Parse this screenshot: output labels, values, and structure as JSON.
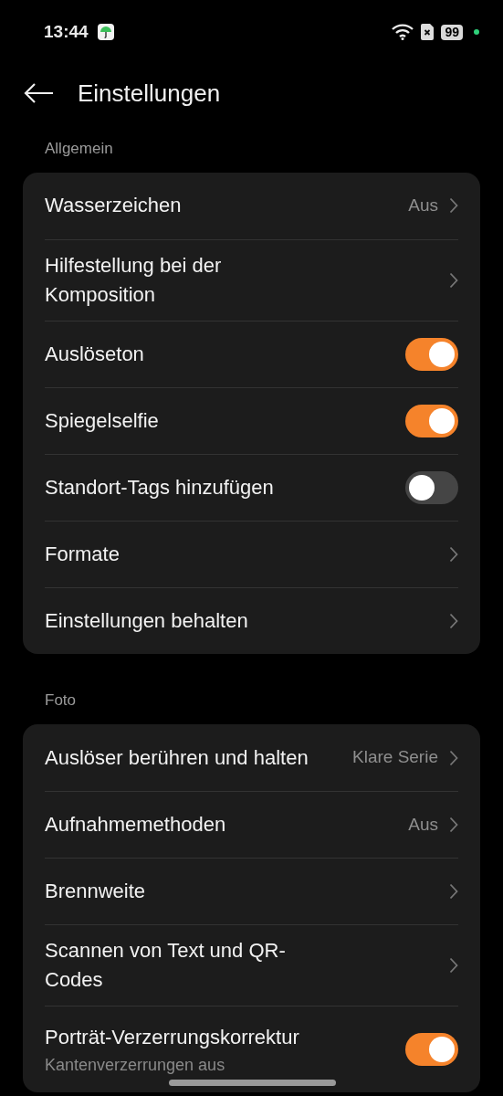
{
  "status_bar": {
    "time": "13:44",
    "battery": "99"
  },
  "header": {
    "title": "Einstellungen"
  },
  "sections": [
    {
      "title": "Allgemein",
      "items": [
        {
          "kind": "link",
          "label": "Wasserzeichen",
          "value": "Aus"
        },
        {
          "kind": "link",
          "label": "Hilfestellung bei der Komposition"
        },
        {
          "kind": "toggle",
          "label": "Auslöseton",
          "on": true
        },
        {
          "kind": "toggle",
          "label": "Spiegelselfie",
          "on": true
        },
        {
          "kind": "toggle",
          "label": "Standort-Tags hinzufügen",
          "on": false
        },
        {
          "kind": "link",
          "label": "Formate"
        },
        {
          "kind": "link",
          "label": "Einstellungen behalten"
        }
      ]
    },
    {
      "title": "Foto",
      "items": [
        {
          "kind": "link",
          "label": "Auslöser berühren und halten",
          "value": "Klare Serie"
        },
        {
          "kind": "link",
          "label": "Aufnahmemethoden",
          "value": "Aus"
        },
        {
          "kind": "link",
          "label": "Brennweite"
        },
        {
          "kind": "link",
          "label": "Scannen von Text und QR-Codes"
        },
        {
          "kind": "toggle",
          "label": "Porträt-Verzerrungskorrektur",
          "subtitle": "Kantenverzerrungen aus",
          "on": true
        }
      ]
    }
  ]
}
